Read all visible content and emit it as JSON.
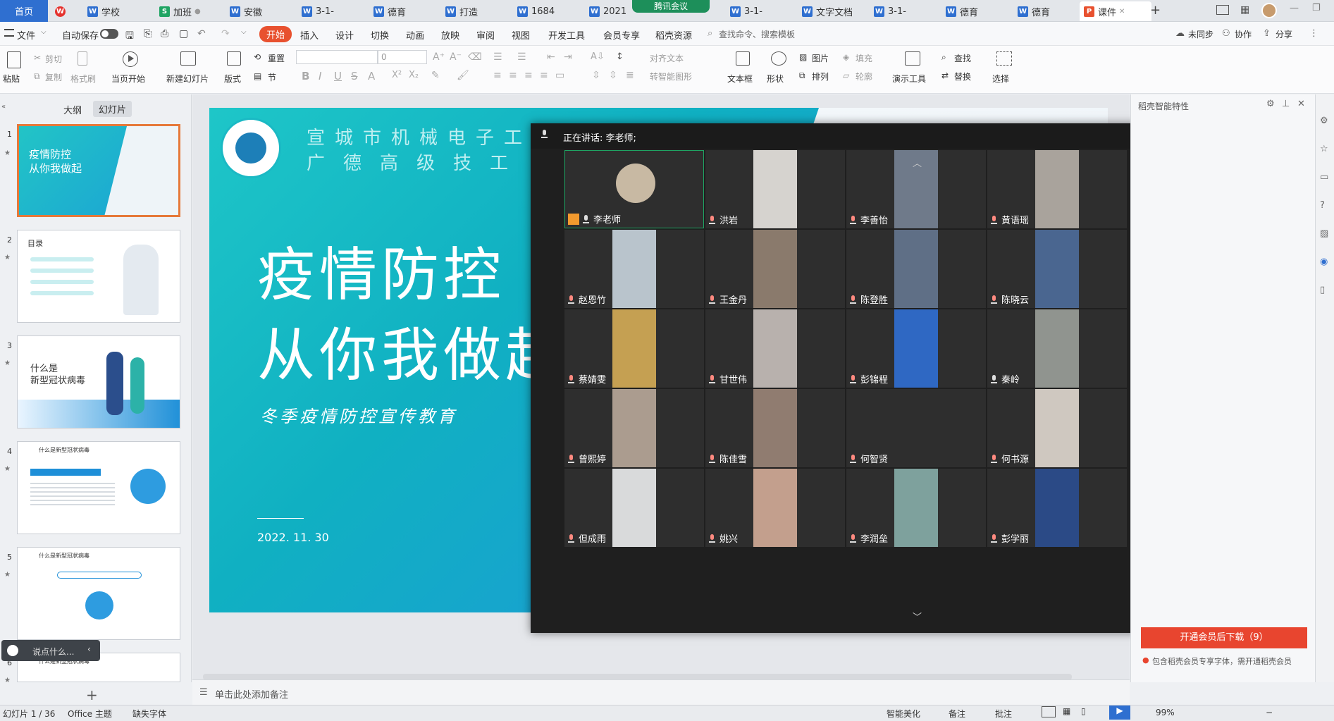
{
  "tabs": [
    {
      "label": "首页",
      "type": "home",
      "color": "#2f6fd0"
    },
    {
      "label": "",
      "type": "wps",
      "color": "#e5322d"
    },
    {
      "label": "学校",
      "type": "W",
      "color": "#2f6fd0"
    },
    {
      "label": "加班",
      "type": "S",
      "color": "#1fa463"
    },
    {
      "label": "安徽",
      "type": "W",
      "color": "#2f6fd0"
    },
    {
      "label": "3-1-",
      "type": "W",
      "color": "#2f6fd0"
    },
    {
      "label": "德育",
      "type": "W",
      "color": "#2f6fd0"
    },
    {
      "label": "打造",
      "type": "W",
      "color": "#2f6fd0"
    },
    {
      "label": "1684",
      "type": "W",
      "color": "#2f6fd0"
    },
    {
      "label": "2021",
      "type": "W",
      "color": "#2f6fd0"
    },
    {
      "label": "3-1-",
      "type": "W",
      "color": "#2f6fd0"
    },
    {
      "label": "文字文档",
      "type": "W",
      "color": "#2f6fd0"
    },
    {
      "label": "3-1-",
      "type": "W",
      "color": "#2f6fd0"
    },
    {
      "label": "德育",
      "type": "W",
      "color": "#2f6fd0"
    },
    {
      "label": "德育",
      "type": "W",
      "color": "#2f6fd0"
    },
    {
      "label": "课件",
      "type": "P",
      "color": "#e8512f"
    }
  ],
  "meeting_pill": "腾讯会议",
  "menu": {
    "file": "文件",
    "autosave": "自动保存",
    "start": "开始",
    "insert": "插入",
    "design": "设计",
    "transition": "切换",
    "animation": "动画",
    "slideshow": "放映",
    "review": "审阅",
    "view": "视图",
    "devtools": "开发工具",
    "vip": "会员专享",
    "resources": "稻壳资源",
    "search_placeholder": "查找命令、搜索模板",
    "sync": "未同步",
    "collab": "协作",
    "share": "分享"
  },
  "ribbon": {
    "paste": "粘贴",
    "cut": "剪切",
    "copy": "复制",
    "format_painter": "格式刷",
    "play_from_current": "当页开始",
    "new_slide": "新建幻灯片",
    "layout": "版式",
    "reset": "重置",
    "section": "节",
    "font_size": "0",
    "align_text": "对齐文本",
    "smartart": "转智能图形",
    "textbox": "文本框",
    "shape": "形状",
    "picture": "图片",
    "fill": "填充",
    "arrange": "排列",
    "outline": "轮廓",
    "present_tools": "演示工具",
    "find": "查找",
    "replace": "替换",
    "select": "选择"
  },
  "left_panel": {
    "outline_tab": "大纲",
    "slides_tab": "幻灯片",
    "chat_placeholder": "说点什么...",
    "thumbs": [
      {
        "num": "1",
        "title": "疫情防控\n从你我做起"
      },
      {
        "num": "2",
        "title": "目录"
      },
      {
        "num": "3",
        "title": "什么是\n新型冠状病毒"
      },
      {
        "num": "4",
        "title": "什么是新型冠状病毒"
      },
      {
        "num": "5",
        "title": "什么是新型冠状病毒"
      },
      {
        "num": "6",
        "title": "什么是新型冠状病毒"
      }
    ]
  },
  "slide": {
    "school_line1": "宣城市机械电子工程",
    "school_line2": "广德高级技工",
    "title_line1": "疫情防控",
    "title_line2": "从你我做起",
    "subtitle": "冬季疫情防控宣传教育",
    "date": "2022. 11. 30"
  },
  "meeting": {
    "speaking": "正在讲话: 李老师;",
    "participants": [
      {
        "name": "李老师",
        "mic": "on",
        "host": true,
        "video": "#c8b9a3"
      },
      {
        "name": "洪岩",
        "mic": "off",
        "video": "#d6d3cf"
      },
      {
        "name": "李善怡",
        "mic": "off",
        "video": "#6f7a8a"
      },
      {
        "name": "黄语瑶",
        "mic": "off",
        "video": "#a9a39c"
      },
      {
        "name": "赵恩竹",
        "mic": "off",
        "video": "#b9c4cc"
      },
      {
        "name": "王金丹",
        "mic": "off",
        "video": "#8a7a6c"
      },
      {
        "name": "陈登胜",
        "mic": "off",
        "video": "#5f6f86"
      },
      {
        "name": "陈晓云",
        "mic": "off",
        "video": "#4a6690"
      },
      {
        "name": "蔡婧雯",
        "mic": "off",
        "video": "#c5a052"
      },
      {
        "name": "甘世伟",
        "mic": "off",
        "video": "#b8b1ad"
      },
      {
        "name": "彭锦程",
        "mic": "off",
        "video": "#2f68c3"
      },
      {
        "name": "秦岭",
        "mic": "on",
        "video": "#90948f"
      },
      {
        "name": "曾熙婷",
        "mic": "off",
        "video": "#ab9c8f"
      },
      {
        "name": "陈佳雪",
        "mic": "off",
        "video": "#907c70"
      },
      {
        "name": "何智贤",
        "mic": "off",
        "video": "#2e2e2e"
      },
      {
        "name": "何书源",
        "mic": "off",
        "video": "#cfc8c0"
      },
      {
        "name": "但成雨",
        "mic": "off",
        "video": "#d9dadb"
      },
      {
        "name": "姚兴",
        "mic": "off",
        "video": "#c39f8d"
      },
      {
        "name": "李润垒",
        "mic": "off",
        "video": "#7ea19d"
      },
      {
        "name": "彭学丽",
        "mic": "off",
        "video": "#2b4a86"
      }
    ]
  },
  "right_panel": {
    "title": "稻壳智能特性",
    "download_btn": "开通会员后下载（9）",
    "vip_note": "包含稻壳会员专享字体，需开通稻壳会员"
  },
  "notes_placeholder": "单击此处添加备注",
  "status": {
    "slide_count": "幻灯片 1 / 36",
    "theme": "Office 主题",
    "missing_font": "缺失字体",
    "beautify": "智能美化",
    "notes": "备注",
    "comment": "批注",
    "zoom": "99%"
  }
}
